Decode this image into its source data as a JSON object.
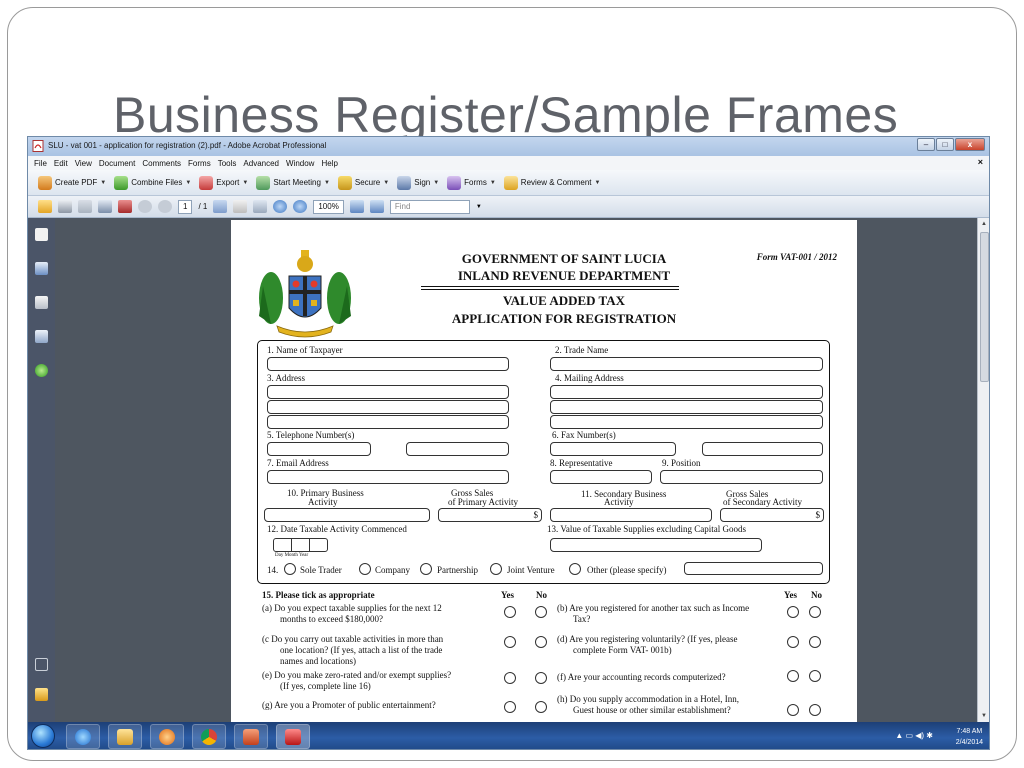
{
  "slide": {
    "title": "Business Register/Sample Frames"
  },
  "window": {
    "title": "SLU - vat 001 - application for registration (2).pdf - Adobe Acrobat Professional",
    "minimize": "–",
    "maximize": "□",
    "close": "x"
  },
  "menu": [
    "File",
    "Edit",
    "View",
    "Document",
    "Comments",
    "Forms",
    "Tools",
    "Advanced",
    "Window",
    "Help"
  ],
  "menu_close": "×",
  "toolbar": {
    "create_pdf": "Create PDF",
    "combine_files": "Combine Files",
    "export": "Export",
    "start_meeting": "Start Meeting",
    "secure": "Secure",
    "sign": "Sign",
    "forms": "Forms",
    "review": "Review & Comment"
  },
  "nav": {
    "page": "1",
    "of": "/ 1",
    "zoom": "100%",
    "find_placeholder": "Find"
  },
  "form": {
    "header1": "GOVERNMENT OF SAINT LUCIA",
    "header2": "INLAND REVENUE DEPARTMENT",
    "header3": "VALUE ADDED TAX",
    "header4": "APPLICATION FOR REGISTRATION",
    "form_no": "Form VAT-001 / 2012",
    "f1": "1.  Name of Taxpayer",
    "f2": "2.  Trade Name",
    "f3": "3.  Address",
    "f4": "4.  Mailing Address",
    "f5": "5.  Telephone Number(s)",
    "f6": "6.  Fax Number(s)",
    "f7": "7. Email Address",
    "f8": "8.  Representative",
    "f9": "9.  Position",
    "f10a": "10.  Primary Business",
    "f10b": "Activity",
    "f10c": "Gross Sales",
    "f10d": "of Primary Activity",
    "f11a": "11.  Secondary Business",
    "f11b": "Activity",
    "f11c": "Gross Sales",
    "f11d": "of Secondary Activity",
    "dollar": "$",
    "f12": "12.  Date Taxable Activity Commenced",
    "f12d": "Day  Month  Year",
    "f13": "13.  Value of Taxable Supplies excluding Capital Goods",
    "f14": "14.",
    "sole": "Sole Trader",
    "company": "Company",
    "partnership": "Partnership",
    "joint": "Joint Venture",
    "other": "Other (please specify)",
    "q15": "15.  Please tick as appropriate",
    "yes": "Yes",
    "no": "No",
    "qa1": "(a)  Do you expect taxable supplies for the next 12",
    "qa2": "months to exceed $180,000?",
    "qb1": "(b) Are you registered for another tax such as Income",
    "qb2": "Tax?",
    "qc1": "(c  Do you carry out taxable activities in more than",
    "qc2": "one location? (If yes, attach a list of the trade",
    "qc3": "names and locations)",
    "qd1": "(d) Are you registering voluntarily? (If yes, please",
    "qd2": "complete Form VAT- 001b)",
    "qe1": "(e)  Do you make zero-rated and/or exempt supplies?",
    "qe2": "(If yes, complete line 16)",
    "qf1": "(f)  Are your accounting records computerized?",
    "qg1": "(g)  Are you a Promoter of public entertainment?",
    "qh1": "(h) Do you supply accommodation in a Hotel, Inn,",
    "qh2": "Guest house or other similar establishment?"
  },
  "tray": {
    "time": "7:48 AM",
    "date": "2/4/2014"
  }
}
